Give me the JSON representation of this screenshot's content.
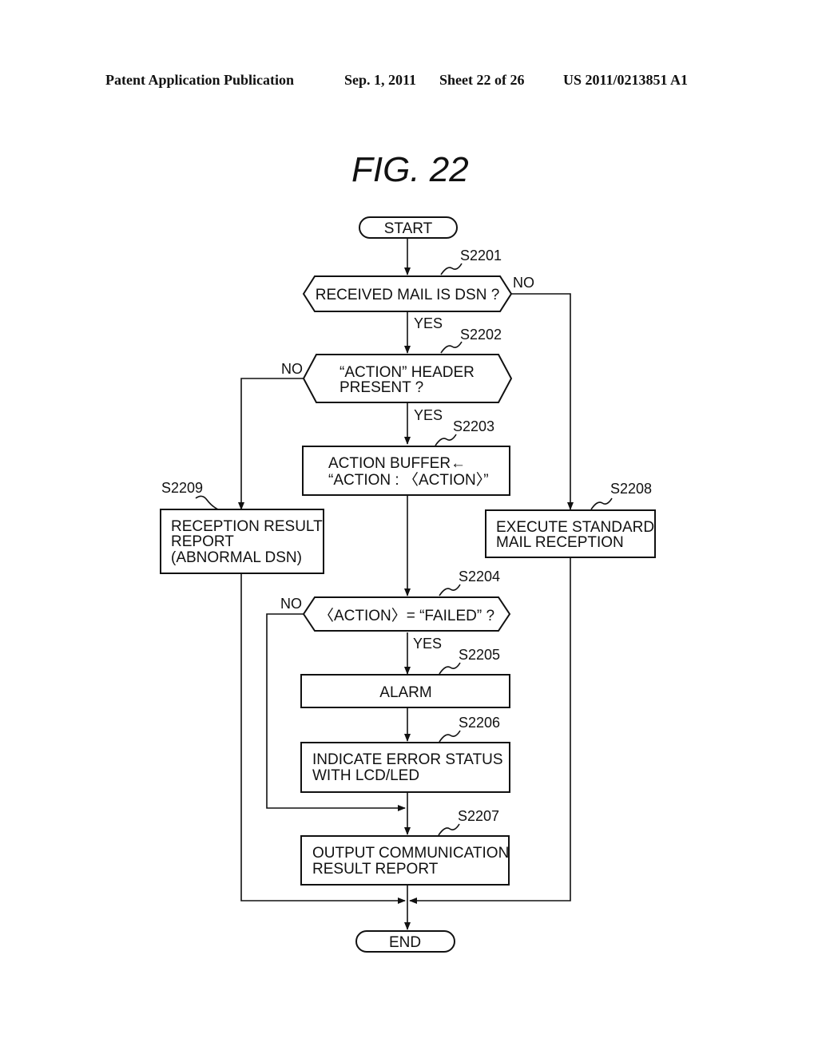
{
  "header": {
    "publication": "Patent Application Publication",
    "date": "Sep. 1, 2011",
    "sheet": "Sheet 22 of 26",
    "number": "US 2011/0213851 A1"
  },
  "figure": {
    "title": "FIG.  22"
  },
  "nodes": {
    "start": {
      "label": "START"
    },
    "s2201": {
      "step": "S2201",
      "label": "RECEIVED  MAIL  IS  DSN  ?"
    },
    "s2202": {
      "step": "S2202",
      "line1": "“ACTION”  HEADER",
      "line2": "PRESENT  ?"
    },
    "s2203": {
      "step": "S2203",
      "line1": "ACTION  BUFFER←",
      "line2": "“ACTION : 〈ACTION〉”"
    },
    "s2204": {
      "step": "S2204",
      "label": "〈ACTION〉= “FAILED”  ?"
    },
    "s2205": {
      "step": "S2205",
      "label": "ALARM"
    },
    "s2206": {
      "step": "S2206",
      "line1": "INDICATE  ERROR  STATUS",
      "line2": "WITH  LCD/LED"
    },
    "s2207": {
      "step": "S2207",
      "line1": "OUTPUT  COMMUNICATION",
      "line2": "RESULT  REPORT"
    },
    "s2208": {
      "step": "S2208",
      "line1": "EXECUTE  STANDARD",
      "line2": "MAIL  RECEPTION"
    },
    "s2209": {
      "step": "S2209",
      "line1": "RECEPTION  RESULT",
      "line2": "REPORT",
      "line3": "(ABNORMAL  DSN)"
    },
    "end": {
      "label": "END"
    }
  },
  "branches": {
    "yes": "YES",
    "no": "NO"
  }
}
